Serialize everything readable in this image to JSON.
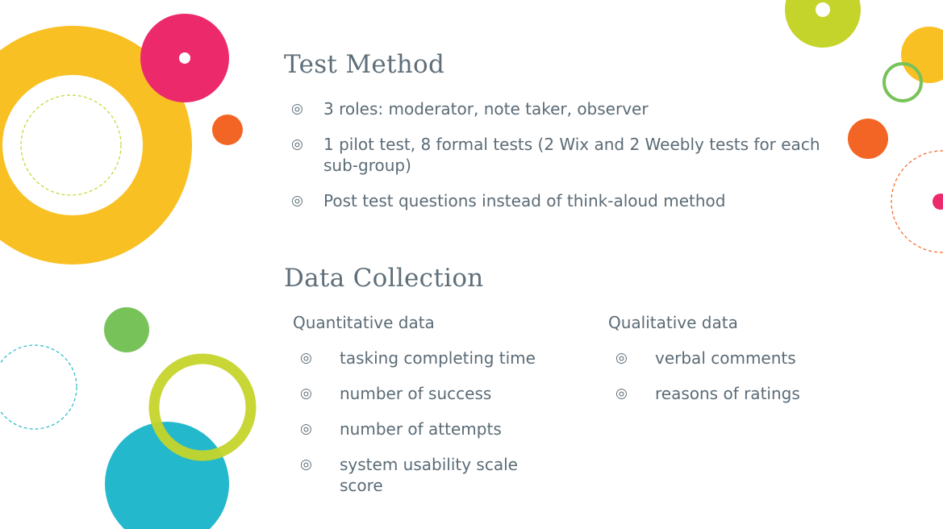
{
  "slide": {
    "test_method": {
      "heading": "Test Method",
      "bullets": [
        "3 roles: moderator, note taker, observer",
        "1 pilot test, 8 formal tests (2 Wix and 2 Weebly tests for each sub-group)",
        "Post test questions instead of think-aloud method"
      ]
    },
    "data_collection": {
      "heading": "Data Collection",
      "quantitative": {
        "heading": "Quantitative data",
        "items": [
          "tasking completing time",
          "number of success",
          "number of attempts",
          "system usability scale score"
        ]
      },
      "qualitative": {
        "heading": "Qualitative data",
        "items": [
          "verbal comments",
          "reasons of ratings"
        ]
      }
    },
    "bullet_icon": "double-circle-bullet",
    "colors": {
      "text": "#5b6b76",
      "yellow": "#f9c023",
      "magenta": "#ec2a6b",
      "orange": "#f26524",
      "green": "#77c35a",
      "lime": "#c5d42b",
      "teal": "#23b8cb"
    }
  }
}
